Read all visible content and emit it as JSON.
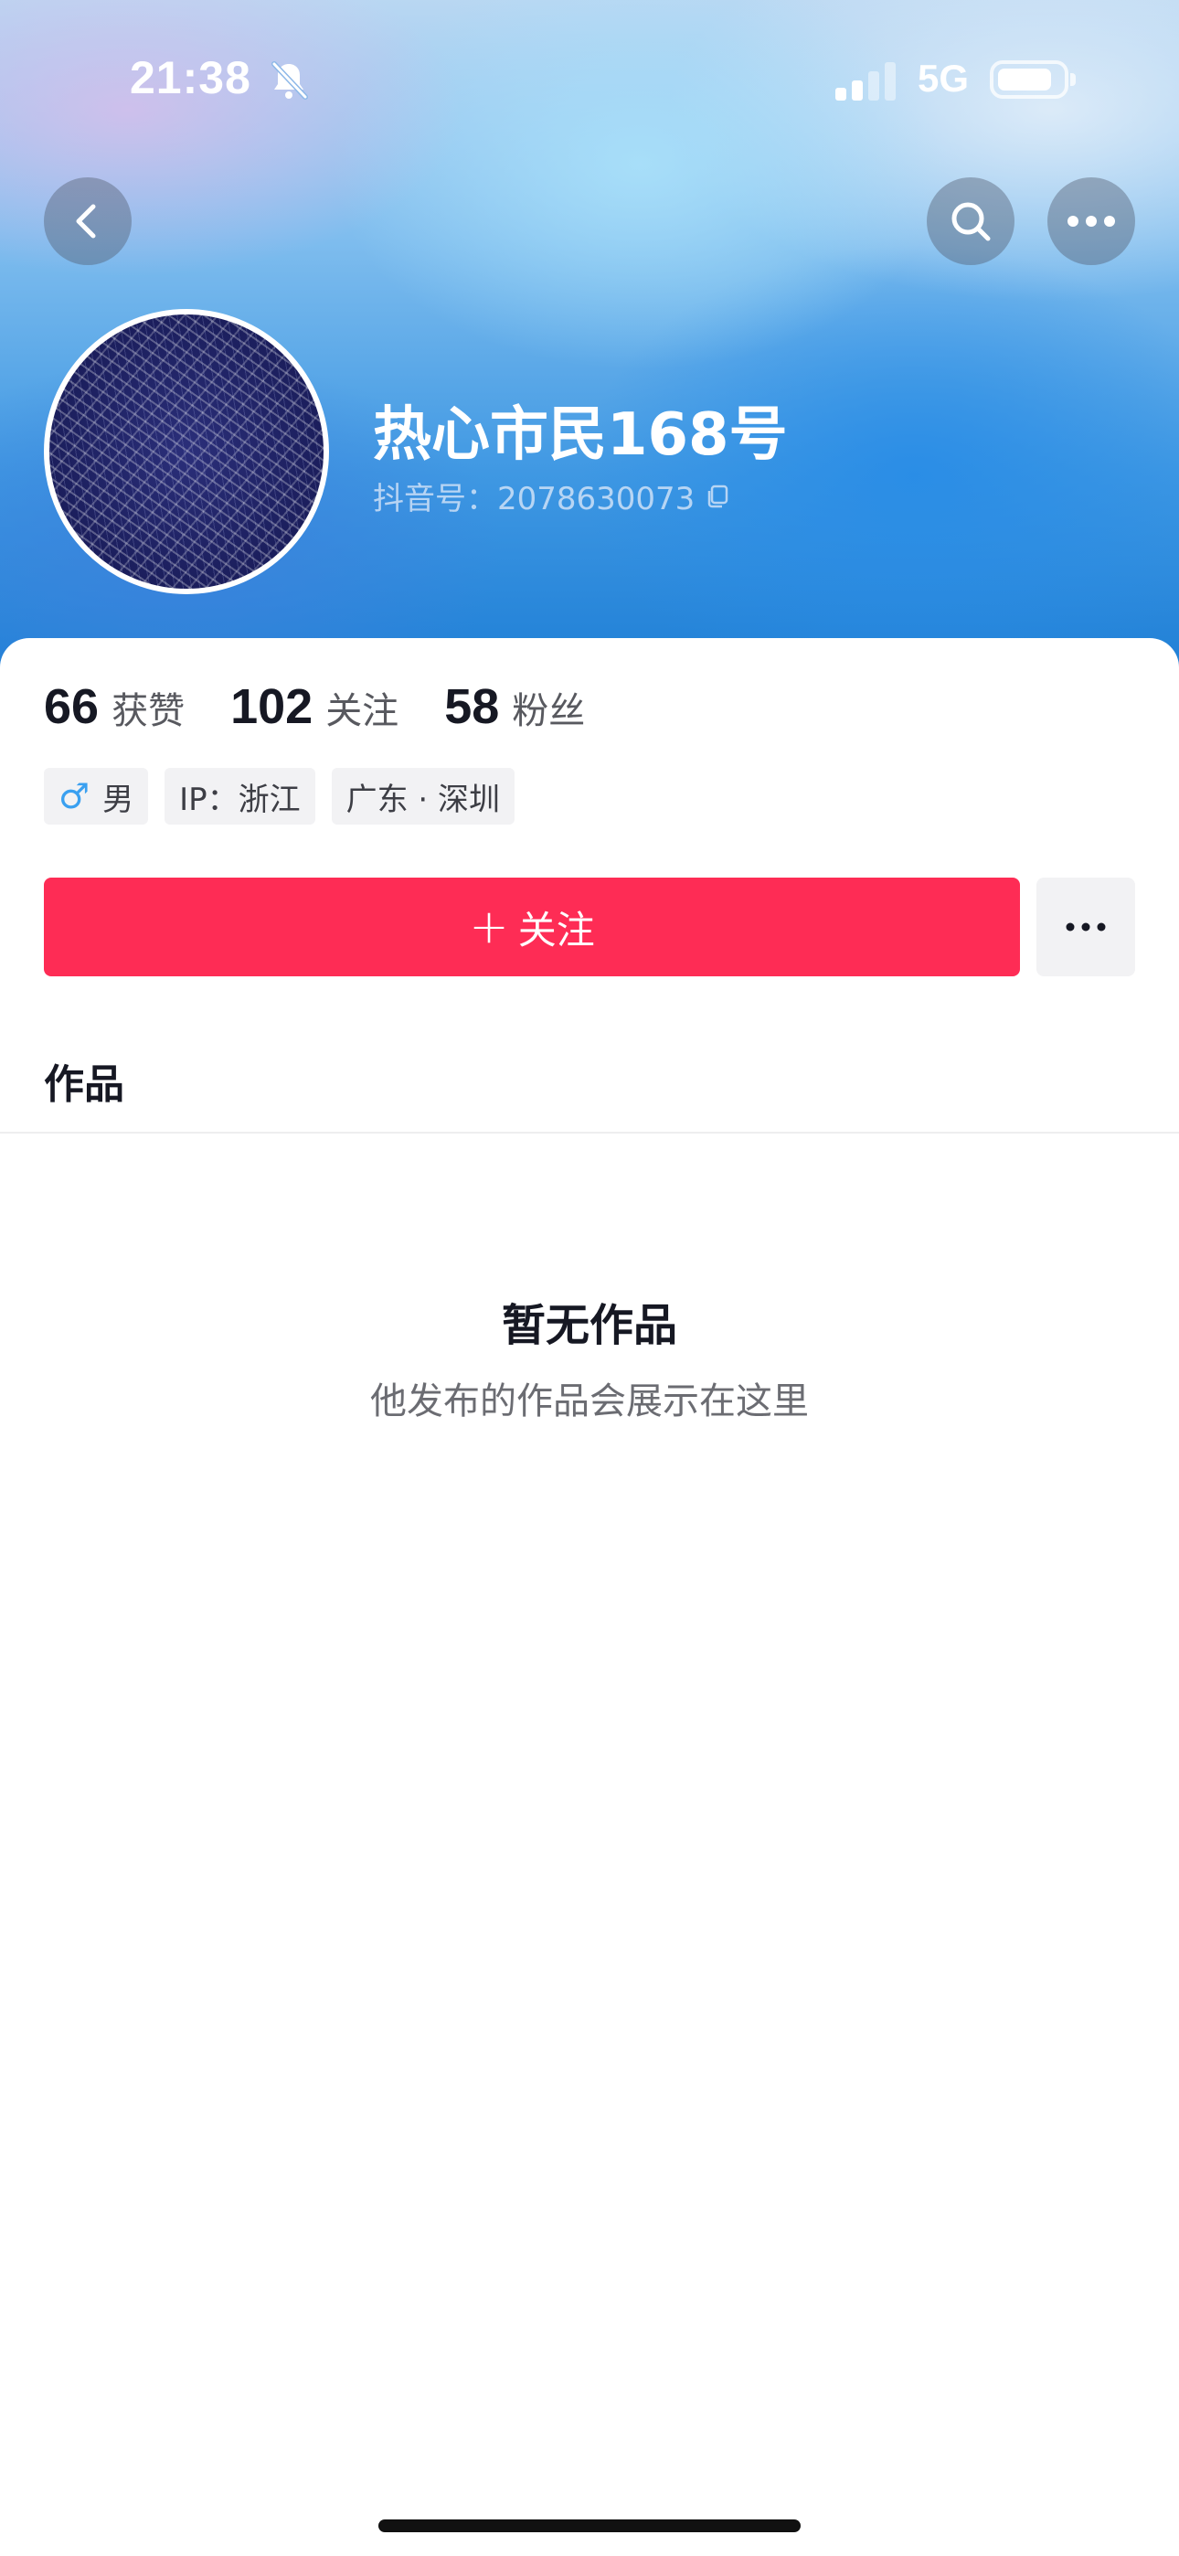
{
  "status_bar": {
    "time": "21:38",
    "network": "5G",
    "icons": [
      "bell-off-icon",
      "signal-icon",
      "battery-icon"
    ]
  },
  "nav": {
    "back_icon": "chevron-left-icon",
    "search_icon": "search-icon",
    "more_icon": "ellipsis-icon"
  },
  "profile": {
    "name": "热心市民168号",
    "douyin_id": "抖音号：2078630073",
    "copy_icon": "copy-icon"
  },
  "stats": [
    {
      "value": "66",
      "label": "获赞"
    },
    {
      "value": "102",
      "label": "关注"
    },
    {
      "value": "58",
      "label": "粉丝"
    }
  ],
  "tags": {
    "gender_symbol": "♂",
    "gender": "男",
    "ip": "IP：浙江",
    "location": "广东 · 深圳"
  },
  "actions": {
    "follow_plus": "+",
    "follow_label": "关注",
    "more_icon": "ellipsis-icon"
  },
  "tabs": {
    "works": "作品"
  },
  "empty_state": {
    "title": "暂无作品",
    "subtitle": "他发布的作品会展示在这里"
  },
  "colors": {
    "accent": "#fe2c55",
    "gender_icon": "#3aa0f0",
    "text_primary": "#161823"
  }
}
